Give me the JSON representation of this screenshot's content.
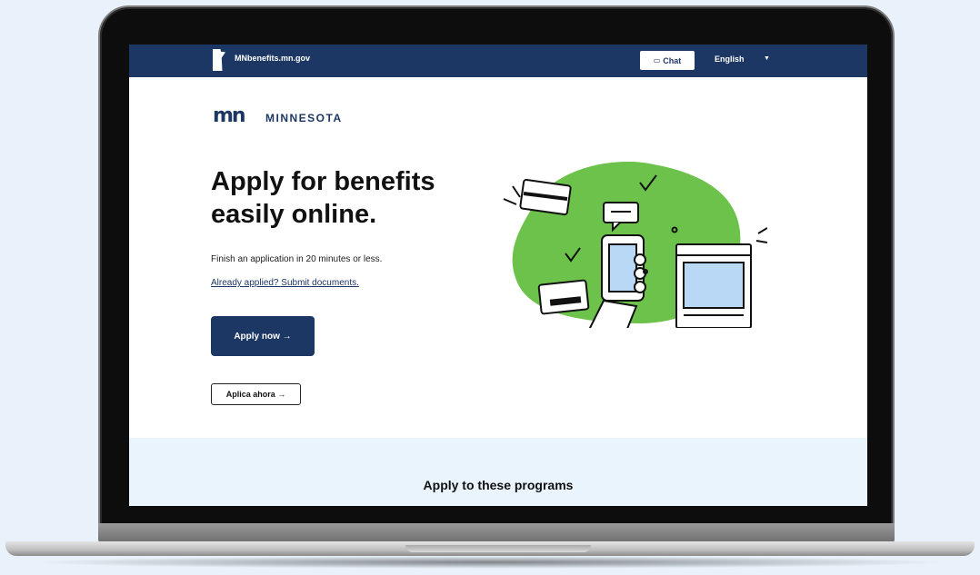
{
  "header": {
    "site_name": "MNbenefits.mn.gov",
    "chat_label": "Chat",
    "chat_icon": "▭",
    "language": "English",
    "language_caret": "▼"
  },
  "brand": {
    "logo_mark": "mn",
    "state_name": "MINNESOTA"
  },
  "hero": {
    "title": "Apply for benefits easily online.",
    "subtitle": "Finish an application in 20 minutes or less.",
    "submit_link": "Already applied? Submit documents.",
    "apply_button": "Apply now →",
    "aplica_button": "Aplica ahora →"
  },
  "programs": {
    "heading": "Apply to these programs"
  },
  "colors": {
    "navy": "#1d3764",
    "accent_green": "#6cc24a",
    "section_bg": "#eaf4fd"
  },
  "icons": {
    "chat": "chat-icon",
    "caret": "chevron-down-icon",
    "state": "minnesota-state-icon"
  }
}
